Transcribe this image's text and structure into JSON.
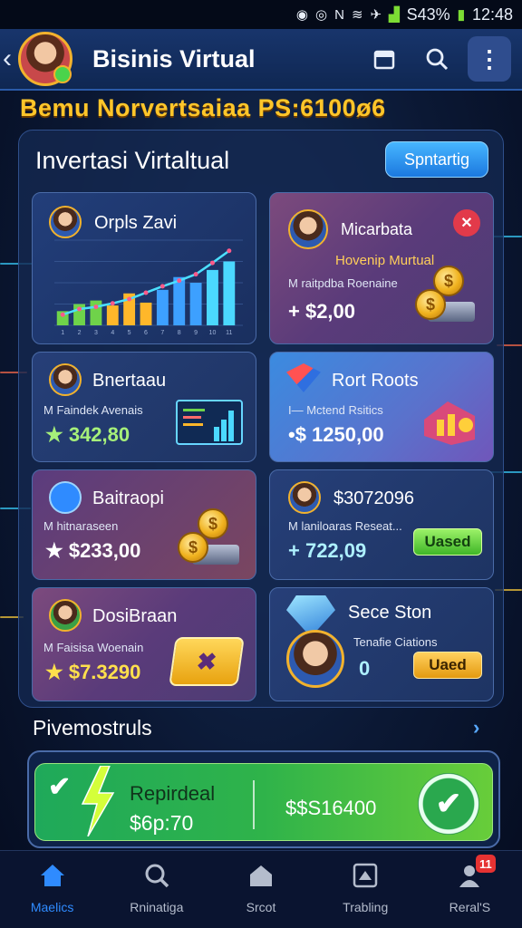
{
  "status_bar": {
    "icons": [
      "camera-icon",
      "alarm-icon",
      "nfc-icon",
      "wifi-icon",
      "location-icon",
      "signal-icon"
    ],
    "battery": "S43%",
    "time": "12:48"
  },
  "app_bar": {
    "back_icon": "chevron-left-icon",
    "title": "Bisinis Virtual",
    "icons": [
      "calendar-icon",
      "search-icon",
      "more-vertical-icon"
    ]
  },
  "banner": "Bemu  Norvertsaiaa PS:6100ø6",
  "panel": {
    "title": "Invertasi Virtaltual",
    "button": "Spntartig"
  },
  "cards": [
    {
      "title": "Orpls Zavi",
      "kind": "chart"
    },
    {
      "title": "Micarbata",
      "subtitle": "Hovenip Murtual",
      "desc": "M   raitpdba Roenaine",
      "value": "+ $2,00"
    },
    {
      "title": "Bnertaau",
      "desc": "M   Faindek Avenais",
      "value": "★ 342,80"
    },
    {
      "title": "Rort Roots",
      "desc": "I—  Mctend Rsitics",
      "value": "•$ 1250,00"
    },
    {
      "title": "Baitraopi",
      "desc": "M   hitnaraseen",
      "value": "★ $233,00"
    },
    {
      "title": "$3072096",
      "desc": "M   laniloaras Reseat...",
      "value": "+ 722,09",
      "button": "Uased"
    },
    {
      "title": "DosiBraan",
      "desc": "M   Faisisa Woenain",
      "value": "★ $7.3290"
    },
    {
      "title": "Sece Ston",
      "desc": "Tenafie Ciations",
      "value": "0",
      "button": "Uaed"
    }
  ],
  "chart_data": {
    "type": "bar",
    "title": "",
    "categories": [
      "1",
      "2",
      "3",
      "4",
      "5",
      "6",
      "7",
      "8",
      "9",
      "10",
      "11"
    ],
    "values": [
      2,
      3,
      3.5,
      2.8,
      4.5,
      3.2,
      5,
      6.8,
      6,
      7.8,
      9
    ],
    "trend": [
      1.5,
      2.3,
      2.6,
      3.1,
      3.7,
      4.6,
      5.5,
      6.3,
      7.2,
      8.8,
      10.5
    ],
    "ylim": [
      0,
      12
    ],
    "grid": true,
    "colors": [
      "#6fd34a",
      "#ffb72a",
      "#3da0ff",
      "#4bd8ff"
    ]
  },
  "section": {
    "title": "Pivemostruls",
    "more_icon": "chevron-right-icon"
  },
  "promo": {
    "title": "Repirdeal",
    "value_left": "$6p:70",
    "value_right": "$$S16400",
    "check_icon": "checkmark-icon"
  },
  "bottom_nav": [
    {
      "label": "Maelics",
      "icon": "home-icon",
      "active": true
    },
    {
      "label": "Rninatiga",
      "icon": "search-icon",
      "active": false
    },
    {
      "label": "Srcot",
      "icon": "store-icon",
      "active": false
    },
    {
      "label": "Trabling",
      "icon": "trading-icon",
      "active": false
    },
    {
      "label": "Reral'S",
      "icon": "user-icon",
      "active": false,
      "badge": "11"
    }
  ]
}
